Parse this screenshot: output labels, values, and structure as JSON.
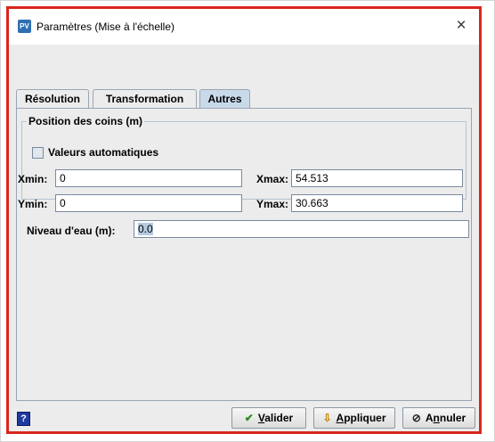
{
  "window": {
    "title": "Paramètres (Mise à l'échelle)",
    "app_icon_text": "PV",
    "close_glyph": "×"
  },
  "tabs": [
    {
      "label": "Résolution",
      "active": false
    },
    {
      "label": "Transformation",
      "active": false
    },
    {
      "label": "Autres",
      "active": true
    }
  ],
  "corners": {
    "legend": "Position des coins (m)",
    "auto_values_label": "Valeurs automatiques",
    "auto_values_checked": false,
    "xmin_label": "Xmin:",
    "xmin_value": "0",
    "xmax_label": "Xmax:",
    "xmax_value": "54.513",
    "ymin_label": "Ymin:",
    "ymin_value": "0",
    "ymax_label": "Ymax:",
    "ymax_value": "30.663"
  },
  "water_level": {
    "label": "Niveau d'eau (m):",
    "value": "0.0"
  },
  "footer": {
    "help_glyph": "?",
    "validate": {
      "first": "V",
      "rest": "alider"
    },
    "apply": {
      "first": "A",
      "rest": "ppliquer"
    },
    "cancel": {
      "pre": "A",
      "mid": "n",
      "post": "nuler"
    }
  },
  "colors": {
    "accent_border": "#d9261c",
    "active_tab": "#c8d9ea",
    "validate_icon": "#2e8b1f",
    "apply_icon": "#c08a00",
    "cancel_icon": "#222222"
  }
}
